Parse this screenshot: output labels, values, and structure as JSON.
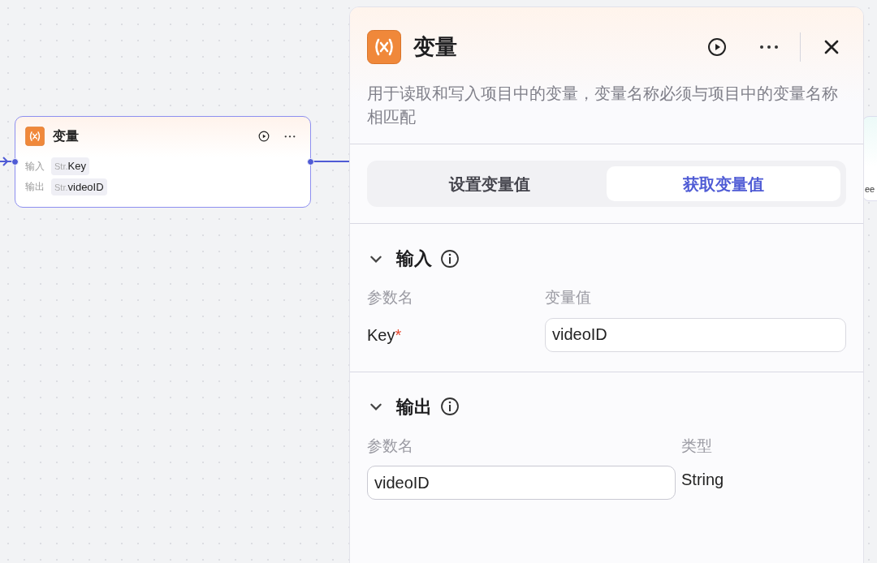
{
  "node": {
    "title": "变量",
    "rows": [
      {
        "label": "输入",
        "type": "Str.",
        "value": "Key"
      },
      {
        "label": "输出",
        "type": "Str.",
        "value": "videoID"
      }
    ]
  },
  "background_node": {
    "text": "ee"
  },
  "panel": {
    "title": "变量",
    "description": "用于读取和写入项目中的变量，变量名称必须与项目中的变量名称相匹配",
    "tabs": [
      {
        "label": "设置变量值",
        "selected": false
      },
      {
        "label": "获取变量值",
        "selected": true
      }
    ],
    "input_section": {
      "title": "输入",
      "expanded": true,
      "columns": [
        "参数名",
        "变量值"
      ],
      "rows": [
        {
          "name": "Key",
          "required": true,
          "required_mark": "*",
          "value": "videoID"
        }
      ]
    },
    "output_section": {
      "title": "输出",
      "expanded": true,
      "columns": [
        "参数名",
        "类型"
      ],
      "rows": [
        {
          "name": "videoID",
          "type": "String"
        }
      ]
    }
  }
}
